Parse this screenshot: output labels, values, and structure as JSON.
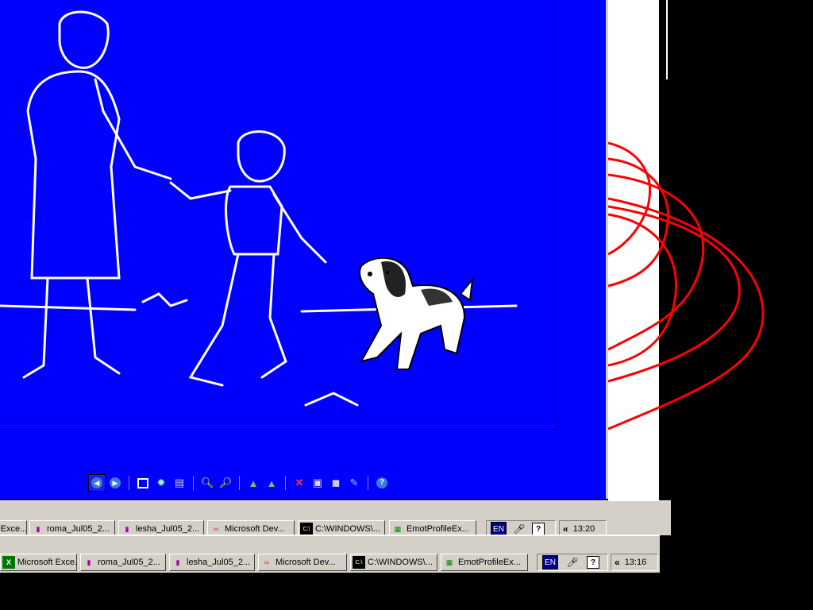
{
  "viewer": {
    "toolbar": {
      "buttons": [
        "prev-image",
        "next-image",
        "fit-window",
        "slideshow",
        "delete",
        "zoom-in",
        "zoom-out",
        "rotate-clockwise",
        "rotate-counterclockwise",
        "close",
        "print",
        "save",
        "edit",
        "help"
      ]
    },
    "colors": {
      "background": "#0000ff",
      "sketch": "#ffffff"
    }
  },
  "back_taskbar": {
    "buttons": [
      {
        "label": "Microsoft Exce...",
        "icon": "excel-icon"
      },
      {
        "label": "roma_Jul05_2...",
        "icon": "document-icon"
      },
      {
        "label": "lesha_Jul05_2...",
        "icon": "document-icon"
      },
      {
        "label": "Microsoft Dev...",
        "icon": "visual-studio-icon"
      },
      {
        "label": "C:\\WINDOWS\\...",
        "icon": "console-icon"
      },
      {
        "label": "EmotProfileEx...",
        "icon": "app-icon"
      }
    ],
    "lang": "EN",
    "clock": "13:20",
    "chevron": "«"
  },
  "front_taskbar": {
    "buttons": [
      {
        "label": "Microsoft Exce...",
        "icon": "excel-icon"
      },
      {
        "label": "roma_Jul05_2...",
        "icon": "document-icon"
      },
      {
        "label": "lesha_Jul05_2...",
        "icon": "document-icon"
      },
      {
        "label": "Microsoft Dev...",
        "icon": "visual-studio-icon"
      },
      {
        "label": "C:\\WINDOWS\\...",
        "icon": "console-icon"
      },
      {
        "label": "EmotProfileEx...",
        "icon": "app-icon"
      }
    ],
    "lang": "EN",
    "clock": "13:16",
    "chevron": "«"
  },
  "back_window": {
    "curve_color": "#ff0000"
  }
}
